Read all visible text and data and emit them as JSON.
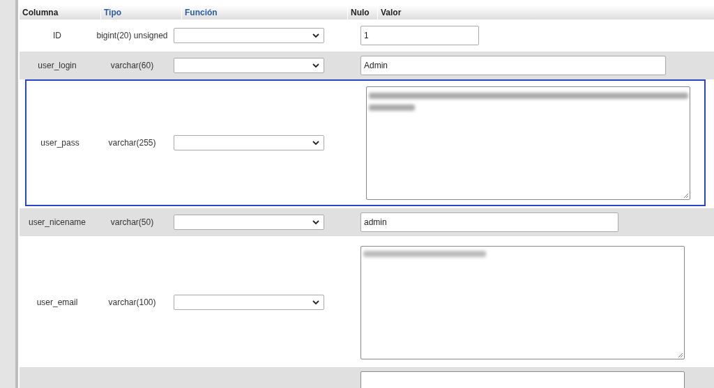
{
  "table": {
    "columns": [
      "Columna",
      "Tipo",
      "Función",
      "Nulo",
      "Valor"
    ],
    "rows": [
      {
        "name": "ID",
        "type": "bigint(20) unsigned",
        "kind": "narrow-input",
        "value": "1",
        "highlighted": false
      },
      {
        "name": "user_login",
        "type": "varchar(60)",
        "kind": "wide-input",
        "value": "Admin",
        "highlighted": false
      },
      {
        "name": "user_pass",
        "type": "varchar(255)",
        "kind": "textarea",
        "redacted": true,
        "multiline": true,
        "highlighted": true
      },
      {
        "name": "user_nicename",
        "type": "varchar(50)",
        "kind": "medium-input",
        "value": "admin",
        "highlighted": false
      },
      {
        "name": "user_email",
        "type": "varchar(100)",
        "kind": "textarea",
        "redacted": true,
        "multiline": false,
        "highlighted": false
      },
      {
        "kind": "textarea-partial",
        "highlighted": false
      }
    ]
  }
}
